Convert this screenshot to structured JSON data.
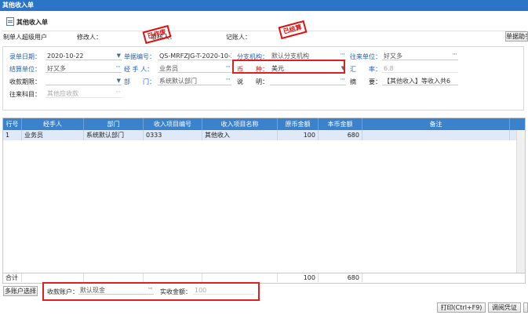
{
  "window": {
    "title": "其他收入单"
  },
  "header": {
    "doc_title": "其他收入单",
    "creator_label": "制单人：",
    "creator_value": "超级用户",
    "modifier_label": "修改人：",
    "auditor_label": "审核人：",
    "bookkeeper_label": "记账人：",
    "helper_button": "单据助手",
    "stamp_invalid": "已作废",
    "stamp_settled": "已结算"
  },
  "form": {
    "date_label": "录单日期：",
    "date_value": "2020-10-22",
    "docno_label": "单据编号：",
    "docno_value": "QS-MRFZJG-T-2020-10-22",
    "branch_label": "分支机构：",
    "branch_value": "默认分支机构",
    "partner_label": "往来单位：",
    "partner_value": "好又多",
    "settle_label": "结算单位：",
    "settle_value": "好又多",
    "handler_label": "经 手 人：",
    "handler_value": "业务员",
    "currency_label": "币　　种：",
    "currency_value": "美元",
    "rate_label": "汇　　率：",
    "rate_value": "6.8",
    "period_label": "收款期限：",
    "dept_label": "部　　门：",
    "dept_value": "系统默认部门",
    "note_label": "说　　明：",
    "summary_label": "摘　　要：",
    "summary_value": "【其他收入】等收入共6",
    "subject_label": "往来科目：",
    "subject_value": "其他应收款"
  },
  "grid": {
    "columns": [
      "行号",
      "经手人",
      "部门",
      "收入项目编号",
      "收入项目名称",
      "原币金额",
      "本币金额",
      "备注"
    ],
    "rows": [
      {
        "no": "1",
        "handler": "业务员",
        "dept": "系统默认部门",
        "code": "0333",
        "name": "其他收入",
        "orig": "100",
        "local": "680",
        "remark": ""
      }
    ],
    "footer": {
      "label": "合计",
      "orig": "100",
      "local": "680"
    }
  },
  "bottom": {
    "multi_account_button": "多账户选择",
    "account_label": "收款账户：",
    "account_value": "默认现金",
    "received_label": "实收金额：",
    "received_value": "100",
    "print_button": "打印(Ctrl+F9)",
    "adjust_button": "调阅凭证"
  }
}
